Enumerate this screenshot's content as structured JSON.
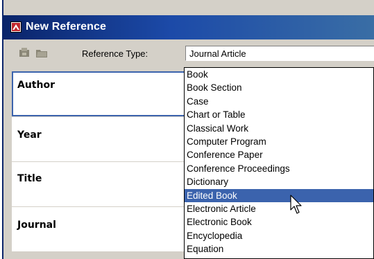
{
  "window": {
    "title": "New Reference",
    "app_icon": "endnote-app-icon"
  },
  "toolbar": {
    "icons": [
      "save-reference-icon",
      "open-folder-icon"
    ],
    "reference_type_label": "Reference Type:",
    "reference_type_value": "Journal Article"
  },
  "form": {
    "fields": [
      "Author",
      "Year",
      "Title",
      "Journal"
    ]
  },
  "dropdown": {
    "options": [
      "Book",
      "Book Section",
      "Case",
      "Chart or Table",
      "Classical Work",
      "Computer Program",
      "Conference Paper",
      "Conference Proceedings",
      "Dictionary",
      "Edited Book",
      "Electronic Article",
      "Electronic Book",
      "Encyclopedia",
      "Equation"
    ],
    "highlighted": "Edited Book"
  },
  "colors": {
    "titlebar": "#0a246a",
    "selection": "#3b63ad",
    "window_face": "#d4d0c8"
  }
}
